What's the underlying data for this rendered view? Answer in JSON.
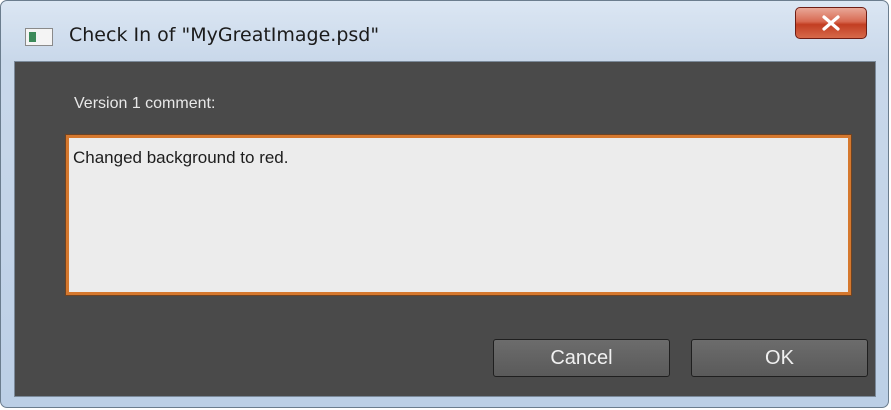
{
  "window": {
    "title": "Check In of \"MyGreatImage.psd\""
  },
  "dialog": {
    "comment_label": "Version 1 comment:",
    "comment_value": "Changed background to red."
  },
  "buttons": {
    "cancel_label": "Cancel",
    "ok_label": "OK"
  },
  "icons": {
    "app": "app-window-icon",
    "close": "close-icon"
  },
  "colors": {
    "client_background": "#4a4a4a",
    "field_focus_border": "#d5782e",
    "close_button": "#c23e22"
  }
}
